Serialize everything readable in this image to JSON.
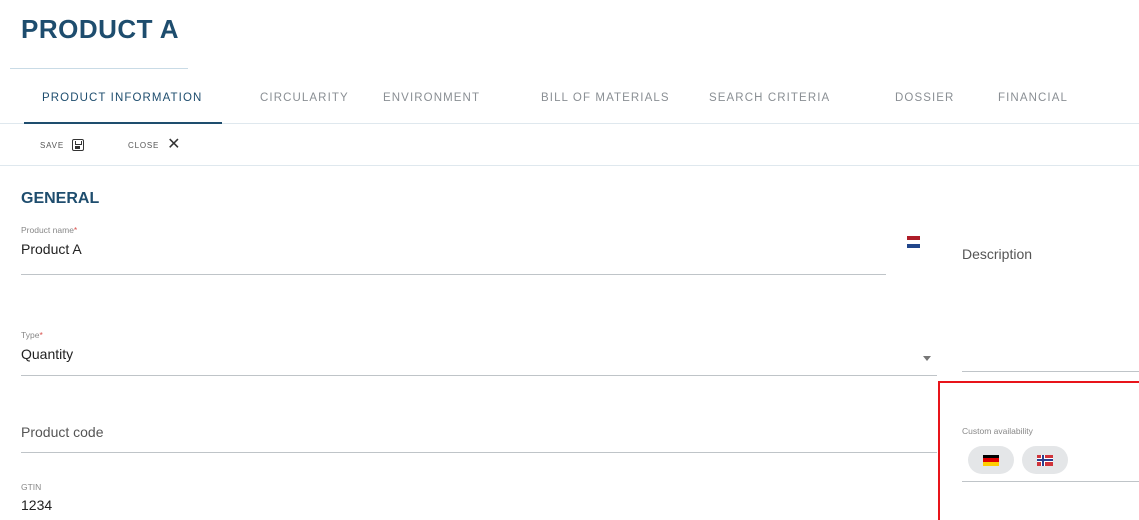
{
  "page": {
    "title": "PRODUCT A"
  },
  "tabs": [
    {
      "label": "PRODUCT INFORMATION",
      "active": true
    },
    {
      "label": "CIRCULARITY",
      "active": false
    },
    {
      "label": "ENVIRONMENT",
      "active": false
    },
    {
      "label": "BILL OF MATERIALS",
      "active": false
    },
    {
      "label": "SEARCH CRITERIA",
      "active": false
    },
    {
      "label": "DOSSIER",
      "active": false
    },
    {
      "label": "FINANCIAL",
      "active": false
    }
  ],
  "toolbar": {
    "save_label": "SAVE",
    "close_label": "CLOSE"
  },
  "section": {
    "title": "GENERAL"
  },
  "fields": {
    "product_name": {
      "label": "Product name",
      "value": "Product A",
      "required": "*"
    },
    "type": {
      "label": "Type",
      "value": "Quantity",
      "required": "*"
    },
    "product_code": {
      "placeholder": "Product code"
    },
    "gtin": {
      "label": "GTIN",
      "value": "1234"
    },
    "description": {
      "placeholder": "Description"
    },
    "custom_availability": {
      "label": "Custom availability"
    }
  },
  "colors": {
    "accent": "#1e4d6e",
    "required": "#d9534f",
    "highlight": "#e8141a",
    "flag_nl": [
      "#ae1c28",
      "#ffffff",
      "#21468b"
    ],
    "flag_de": [
      "#000000",
      "#dd0000",
      "#ffce00"
    ]
  },
  "icons": {
    "save": "save-icon",
    "close": "close-icon",
    "language_flag": "flag-nl-icon",
    "availability": [
      "flag-de-icon",
      "flag-no-icon"
    ]
  }
}
